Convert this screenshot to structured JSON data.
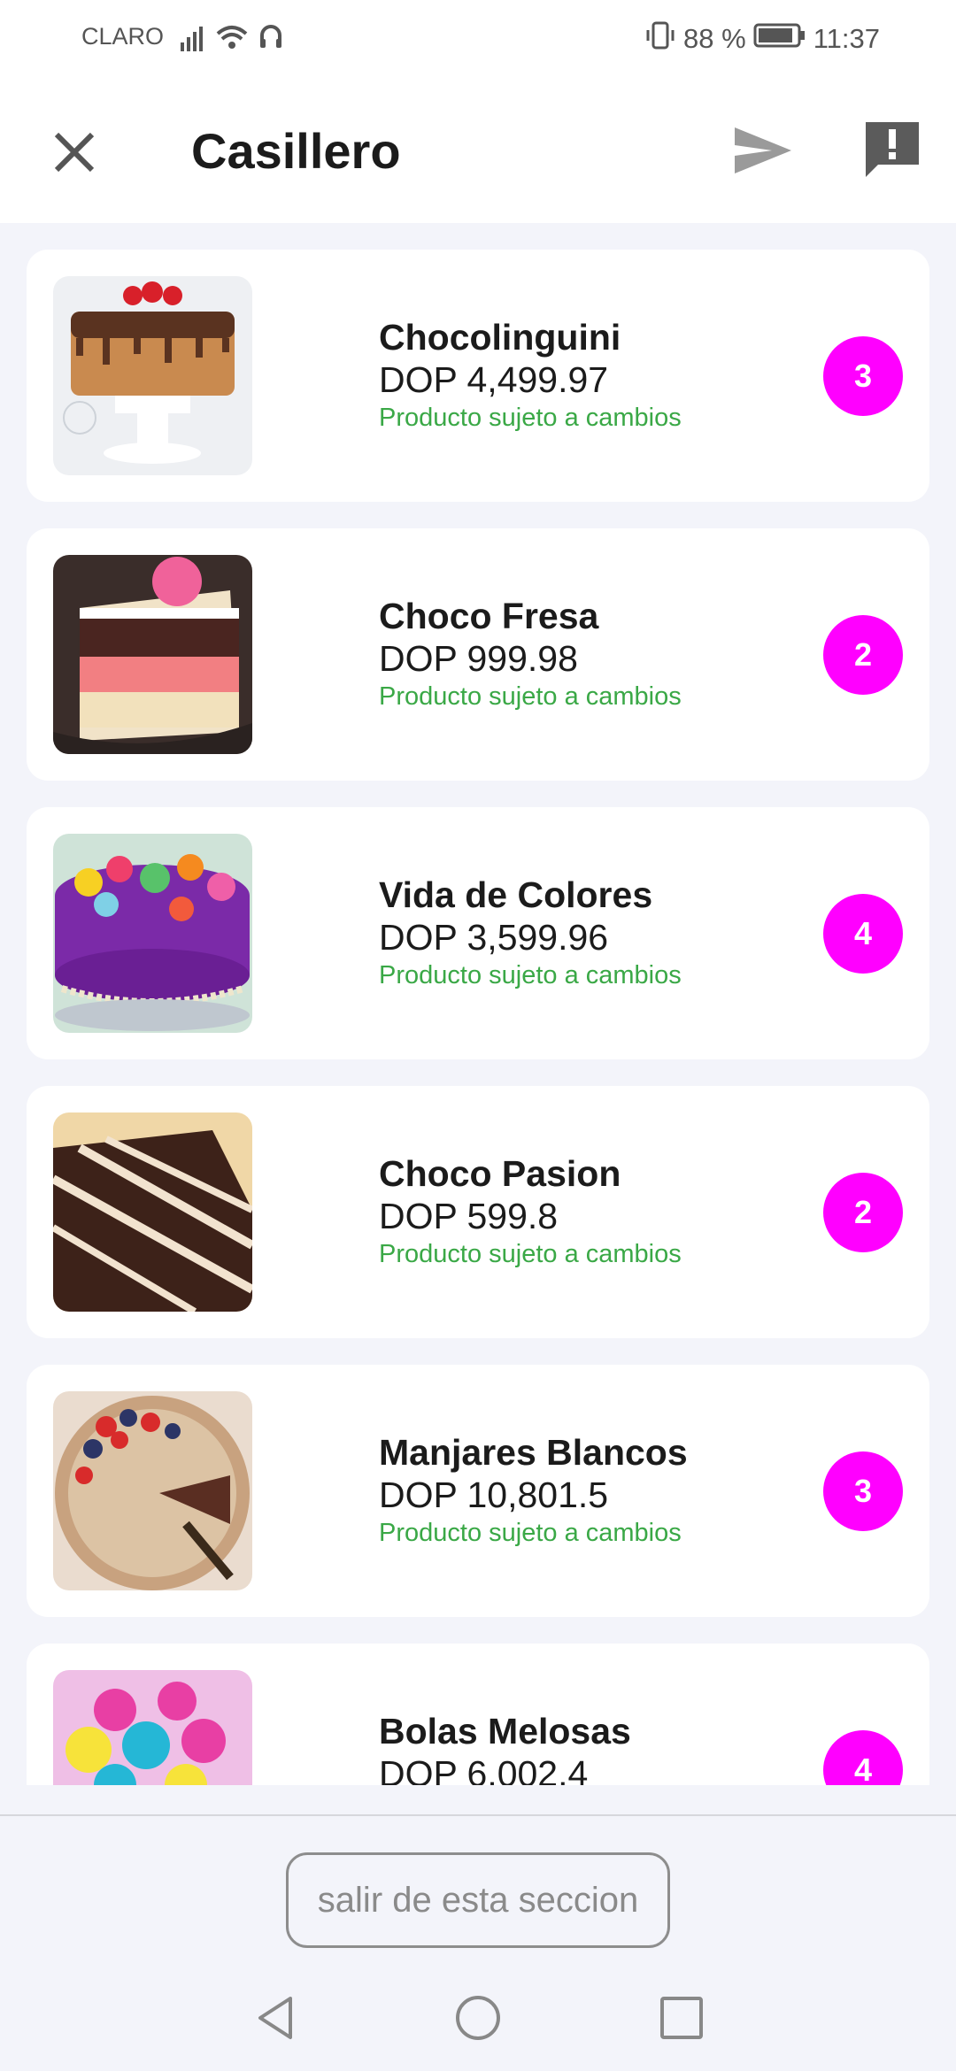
{
  "status_bar": {
    "carrier": "CLARO",
    "battery": "88 %",
    "time": "11:37"
  },
  "app_bar": {
    "title": "Casillero",
    "icons": [
      "close-icon",
      "send-icon",
      "report-icon"
    ]
  },
  "products": [
    {
      "name": "Chocolinguini",
      "price": "DOP 4,499.97",
      "note": "Producto sujeto a cambios",
      "qty": "3"
    },
    {
      "name": "Choco Fresa",
      "price": "DOP 999.98",
      "note": "Producto sujeto a cambios",
      "qty": "2"
    },
    {
      "name": "Vida de Colores",
      "price": "DOP 3,599.96",
      "note": "Producto sujeto a cambios",
      "qty": "4"
    },
    {
      "name": "Choco Pasion",
      "price": "DOP 599.8",
      "note": "Producto sujeto a cambios",
      "qty": "2"
    },
    {
      "name": "Manjares Blancos",
      "price": "DOP 10,801.5",
      "note": "Producto sujeto a cambios",
      "qty": "3"
    },
    {
      "name": "Bolas Melosas",
      "price": "DOP 6,002.4",
      "qty": "4"
    }
  ],
  "footer": {
    "exit_label": "salir de esta seccion"
  },
  "colors": {
    "accent": "#ff00ff",
    "note": "#3aa846",
    "background": "#f3f4fa"
  }
}
